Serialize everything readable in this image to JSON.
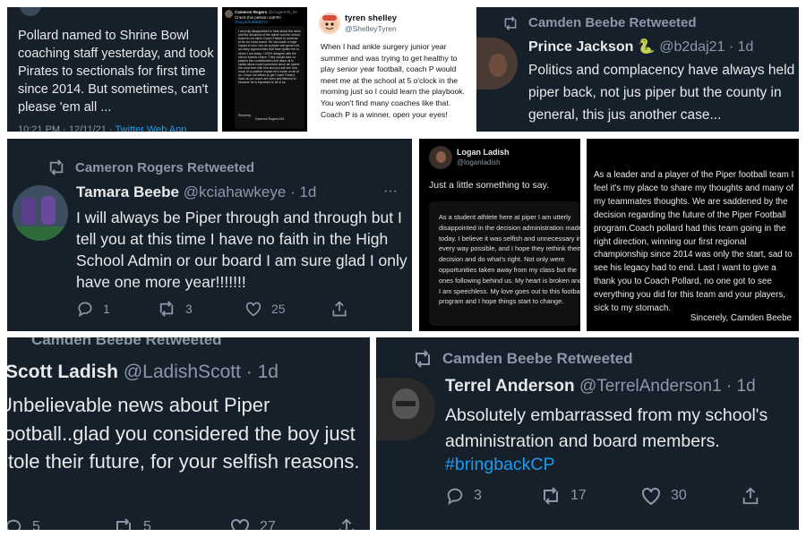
{
  "t1": {
    "text": "Pollard named to Shrine Bowl coaching staff yesterday, and took Pirates to sectionals for first time since 2014. But sometimes, can't please 'em all ...",
    "meta_time": "10:21 PM · 12/11/21 · ",
    "meta_app": "Twitter Web App"
  },
  "t2": {
    "name": "Cameron Rogers",
    "handle": "@crogers70_10",
    "intro": "Check this petition out!!!!!! ",
    "intro_link": "chng.it/ZuBM8SYx",
    "letter": "I am truly disappointed to hear about the news and the decisions of the admin and the school board to not allow Coach Pollard to continue to be our head coach. He has made a huge impact in who I am as a player and grown me as many opportunities that have gotten me to where I am today. I 100% disagree with the school boards choice. They should take us players into consideration and allow us to speak about coach ourselves since we spend the most time with him and you will see how much of a positive impact he's made on all of us. I hope our efforts to get Coach Pollard back as our coach are seen and listened to because he is important to all of us.",
    "sign1": "Sincerely,",
    "sign2": "Cameron Rogers #10"
  },
  "t3": {
    "name": "tyren shelley",
    "handle": "@ShelleyTyren",
    "text": "When I had ankle surgery junior year summer and was trying to get healthy to play senior year football, coach P would meet me at the school at 5 o'clock in the morning just so I could learn the playbook. You won't find many coaches like that. Coach P is a winner, open your eyes!"
  },
  "t4": {
    "retweeted": "Camden Beebe Retweeted",
    "name": "Prince Jackson",
    "emoji": "🐍",
    "handle": "@b2daj21 · 1d",
    "text": "Politics and complacency have always held piper back, not jus piper but the county in general, this jus another case..."
  },
  "t5": {
    "retweeted": "Cameron Rogers Retweeted",
    "name": "Tamara Beebe",
    "handle": "@kciahawkeye · 1d",
    "more": "···",
    "text": "I will always be Piper through and through but I tell you at this time I have no faith in the High School Admin or our board I am sure glad I only have one more year!!!!!!!",
    "replies": "1",
    "retweets": "3",
    "likes": "25"
  },
  "t6": {
    "name": "Logan Ladish",
    "handle": "@loganladish",
    "text": "Just a little something to say.",
    "note": "As a student athlete here at piper I am utterly disappointed in the decision administration made today. I believe it was selfish and unnecessary in every way possible, and I hope they rethink their decision and do what's right. Not only were opportunities taken away from my class but the ones following behind us. My heart is broken and I am speechless. My love goes out to this football program and I hope things start to change."
  },
  "t7": {
    "text": "As a leader and a player of the Piper football team I feel it's my place to share my thoughts and many of my teammates thoughts. We are saddened by the decision regarding the future of the Piper Football program.Coach pollard had this team going in the right direction, winning our first regional championship since 2014 was only the start, sad to see his legacy had to end. Last I want to give a thank you to Coach Pollard, no one got to see everything you did for this team and your players, sick to my stomach.",
    "sign": "Sincerely, Camden Beebe"
  },
  "t8": {
    "retweeted": "Camden Beebe Retweeted",
    "name": "Scott Ladish",
    "handle": "@LadishScott · 1d",
    "text": "Unbelievable news about Piper football..glad you considered the boy just stole their future, for your selfish reasons.",
    "replies": "5",
    "retweets": "5",
    "likes": "27"
  },
  "t9": {
    "retweeted": "Camden Beebe Retweeted",
    "name": "Terrel Anderson",
    "handle": "@TerrelAnderson1 · 1d",
    "text": "Absolutely embarrassed from my school's administration and board members.",
    "hashtag": "#bringbackCP",
    "replies": "3",
    "retweets": "17",
    "likes": "30"
  }
}
